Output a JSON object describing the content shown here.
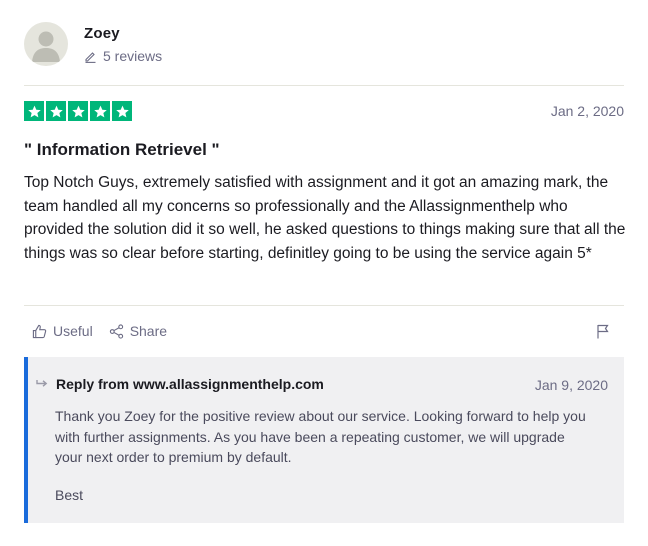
{
  "consumer": {
    "name": "Zoey",
    "reviews_count": "5 reviews"
  },
  "review": {
    "rating": 5,
    "date": "Jan 2, 2020",
    "title": "\" Information Retrievel \"",
    "text": "Top Notch Guys, extremely satisfied with assignment and it got an amazing mark, the team handled all my concerns so professionally and the Allassignmenthelp who provided the solution did it so well, he asked questions to things making sure that all the things was so clear before starting, definitley going to be using the service again 5*"
  },
  "actions": {
    "useful_label": "Useful",
    "share_label": "Share"
  },
  "reply": {
    "from_label": "Reply from www.allassignmenthelp.com",
    "date": "Jan 9, 2020",
    "text": "Thank you Zoey for the positive review about our service. Looking forward to help you with further assignments. As you have been a repeating customer, we will upgrade your next order to premium by default.",
    "signoff": "Best"
  },
  "colors": {
    "star_green": "#00b67a",
    "reply_accent": "#1a6bdb",
    "reply_background": "#f0f0f2",
    "muted_text": "#6c6c85"
  },
  "icons": {
    "avatar": "user-silhouette-icon",
    "reviews": "pencil-icon",
    "star": "star-icon",
    "useful": "thumbs-up-icon",
    "share": "share-icon",
    "flag": "flag-icon",
    "reply": "reply-arrow-icon"
  }
}
